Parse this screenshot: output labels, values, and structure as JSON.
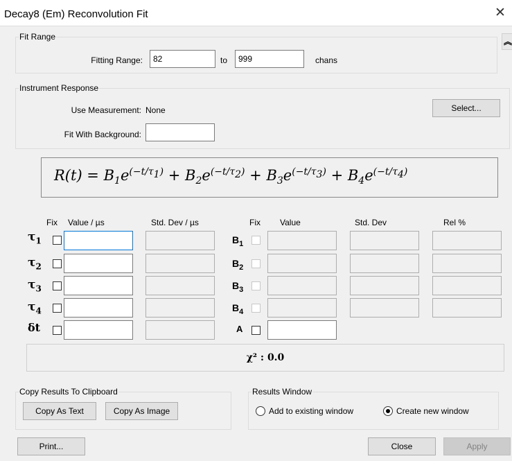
{
  "window": {
    "title": "Decay8 (Em)  Reconvolution Fit"
  },
  "fit_range": {
    "legend": "Fit Range",
    "fitting_range_label": "Fitting Range:",
    "from_value": "82",
    "to_label": "to",
    "to_value": "999",
    "unit": "chans"
  },
  "instrument": {
    "legend": "Instrument Response",
    "use_measurement_label": "Use Measurement:",
    "use_measurement_value": "None",
    "fit_background_label": "Fit With Background:",
    "fit_background_value": "",
    "select_button": "Select..."
  },
  "equation": {
    "lhs": "R(t) = ",
    "terms": [
      {
        "coef": "B",
        "coef_sub": "1",
        "tau_sub": "1"
      },
      {
        "coef": "B",
        "coef_sub": "2",
        "tau_sub": "2"
      },
      {
        "coef": "B",
        "coef_sub": "3",
        "tau_sub": "3"
      },
      {
        "coef": "B",
        "coef_sub": "4",
        "tau_sub": "4"
      }
    ]
  },
  "params": {
    "headers": {
      "fix1": "Fix",
      "value_us": "Value / µs",
      "std_dev_us": "Std. Dev / µs",
      "fix2": "Fix",
      "value": "Value",
      "std_dev": "Std. Dev",
      "rel": "Rel %"
    },
    "tau_rows": [
      {
        "sym": "τ",
        "sub": "1",
        "b_sym": "B",
        "b_sub": "1"
      },
      {
        "sym": "τ",
        "sub": "2",
        "b_sym": "B",
        "b_sub": "2"
      },
      {
        "sym": "τ",
        "sub": "3",
        "b_sym": "B",
        "b_sub": "3"
      },
      {
        "sym": "τ",
        "sub": "4",
        "b_sym": "B",
        "b_sub": "4"
      }
    ],
    "shift_row": {
      "sym": "δt",
      "a_sym": "A"
    },
    "chi_square": "χ² : 0.0"
  },
  "clipboard": {
    "legend": "Copy Results To Clipboard",
    "copy_text": "Copy As Text",
    "copy_image": "Copy As Image"
  },
  "results_window": {
    "legend": "Results Window",
    "option_add": "Add to existing window",
    "option_new": "Create new window",
    "selected": "new"
  },
  "footer": {
    "print": "Print...",
    "close": "Close",
    "apply": "Apply"
  },
  "icons": {
    "close": "close-icon",
    "collapse": "collapse-up-icon"
  },
  "colors": {
    "accent_focus": "#0078d7",
    "background": "#f0f0f0"
  }
}
